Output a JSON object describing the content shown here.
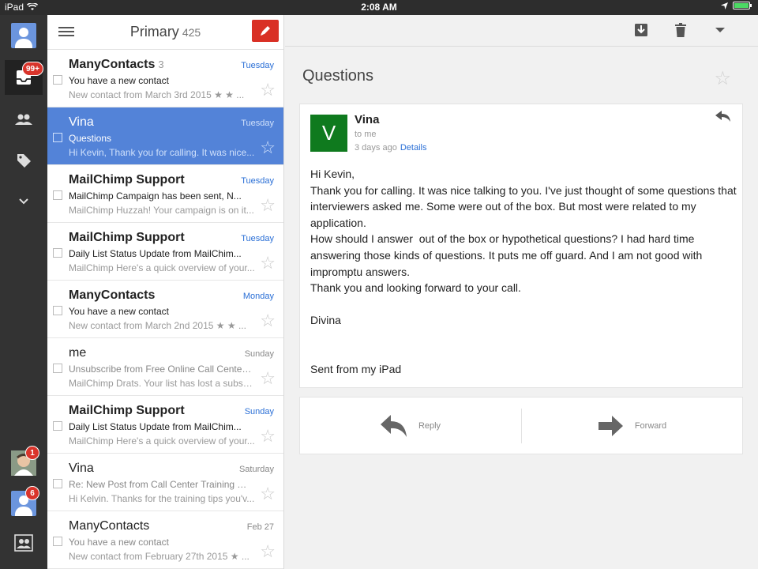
{
  "status_bar": {
    "device": "iPad",
    "time": "2:08 AM"
  },
  "rail": {
    "inbox_badge": "99+",
    "account1_badge": "1",
    "account2_badge": "6"
  },
  "list": {
    "title": "Primary",
    "count": "425",
    "messages": [
      {
        "sender": "ManyContacts",
        "count": "3",
        "date": "Tuesday",
        "subject": "You have a new contact",
        "snippet": "New contact from March 3rd 2015 ★ ★ ...",
        "state": "unread"
      },
      {
        "sender": "Vina",
        "count": "",
        "date": "Tuesday",
        "subject": "Questions",
        "snippet": "Hi Kevin, Thank you for calling. It was nice...",
        "state": "selected"
      },
      {
        "sender": "MailChimp Support",
        "count": "",
        "date": "Tuesday",
        "subject": "MailChimp Campaign has been sent, N...",
        "snippet": "MailChimp Huzzah! Your campaign is on it...",
        "state": "unread"
      },
      {
        "sender": "MailChimp Support",
        "count": "",
        "date": "Tuesday",
        "subject": "Daily List Status Update from MailChim...",
        "snippet": "MailChimp Here's a quick overview of your...",
        "state": "unread"
      },
      {
        "sender": "ManyContacts",
        "count": "",
        "date": "Monday",
        "subject": "You have a new contact",
        "snippet": "New contact from March 2nd 2015 ★ ★ ...",
        "state": "unread"
      },
      {
        "sender": "me",
        "count": "",
        "date": "Sunday",
        "subject": "Unsubscribe from Free Online Call Center...",
        "snippet": "MailChimp Drats. Your list has lost a subsc...",
        "state": "read"
      },
      {
        "sender": "MailChimp Support",
        "count": "",
        "date": "Sunday",
        "subject": "Daily List Status Update from MailChim...",
        "snippet": "MailChimp Here's a quick overview of your...",
        "state": "unread"
      },
      {
        "sender": "Vina",
        "count": "",
        "date": "Saturday",
        "subject": "Re: New Post from Call Center Training Ti...",
        "snippet": "Hi Kelvin. Thanks for the training tips you'v...",
        "state": "read"
      },
      {
        "sender": "ManyContacts",
        "count": "",
        "date": "Feb 27",
        "subject": "You have a new contact",
        "snippet": "New contact from February 27th 2015 ★ ...",
        "state": "read"
      }
    ]
  },
  "reading": {
    "thread_title": "Questions",
    "from": "Vina",
    "avatar_letter": "V",
    "to": "to me",
    "when": "3 days ago",
    "details_label": "Details",
    "body": [
      "Hi Kevin,",
      "Thank you for calling. It was nice talking to you. I've just thought of some questions that interviewers asked me. Some were out of the box. But most were related to my application.",
      "How should I answer  out of the box or hypothetical questions? I had hard time answering those kinds of questions. It puts me off guard. And I am not good with impromptu answers.",
      "Thank you and looking forward to your call.",
      "",
      "Divina",
      "",
      "",
      "Sent from my iPad"
    ],
    "reply_label": "Reply",
    "forward_label": "Forward"
  },
  "icons": {
    "compose": "pencil-icon",
    "archive": "archive-icon",
    "trash": "trash-icon",
    "more": "dropdown-icon",
    "star": "star-icon"
  },
  "colors": {
    "selected_row": "#5383d8",
    "compose": "#d93025",
    "avatar": "#0f7a1e",
    "badge": "#d9342b",
    "link": "#2a6fd6"
  }
}
